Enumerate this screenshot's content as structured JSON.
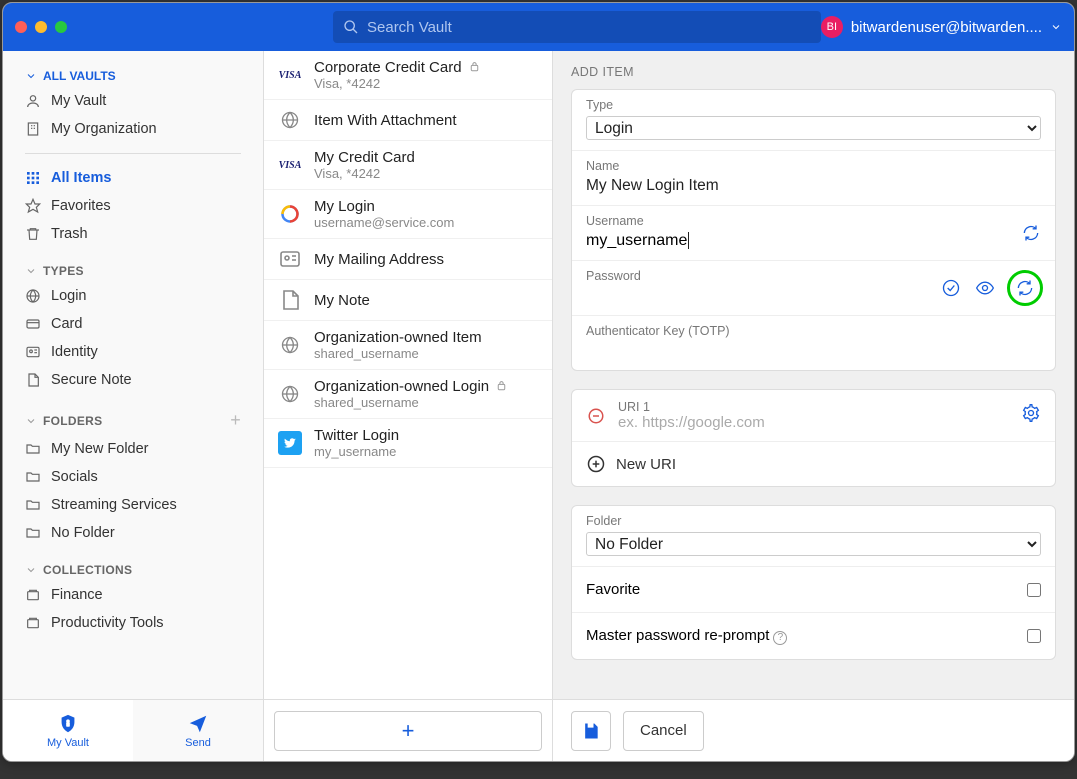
{
  "search": {
    "placeholder": "Search Vault"
  },
  "user": {
    "initials": "BI",
    "email": "bitwardenuser@bitwarden...."
  },
  "sidebar": {
    "all_vaults": "ALL VAULTS",
    "vaults": [
      "My Vault",
      "My Organization"
    ],
    "all_items": "All Items",
    "favorites": "Favorites",
    "trash": "Trash",
    "types_header": "TYPES",
    "types": [
      "Login",
      "Card",
      "Identity",
      "Secure Note"
    ],
    "folders_header": "FOLDERS",
    "folders": [
      "My New Folder",
      "Socials",
      "Streaming Services",
      "No Folder"
    ],
    "collections_header": "COLLECTIONS",
    "collections": [
      "Finance",
      "Productivity Tools"
    ],
    "tab_vault": "My Vault",
    "tab_send": "Send"
  },
  "items": [
    {
      "title": "Corporate Credit Card",
      "sub": "Visa, *4242",
      "icon": "visa",
      "attachment": true
    },
    {
      "title": "Item With Attachment",
      "sub": "",
      "icon": "globe"
    },
    {
      "title": "My Credit Card",
      "sub": "Visa, *4242",
      "icon": "visa"
    },
    {
      "title": "My Login",
      "sub": "username@service.com",
      "icon": "google"
    },
    {
      "title": "My Mailing Address",
      "sub": "",
      "icon": "identity"
    },
    {
      "title": "My Note",
      "sub": "",
      "icon": "note"
    },
    {
      "title": "Organization-owned Item",
      "sub": "shared_username",
      "icon": "globe"
    },
    {
      "title": "Organization-owned Login",
      "sub": "shared_username",
      "icon": "globe",
      "attachment": true
    },
    {
      "title": "Twitter Login",
      "sub": "my_username",
      "icon": "twitter"
    }
  ],
  "detail": {
    "header": "ADD ITEM",
    "type_label": "Type",
    "type_value": "Login",
    "name_label": "Name",
    "name_value": "My New Login Item",
    "username_label": "Username",
    "username_value": "my_username",
    "password_label": "Password",
    "totp_label": "Authenticator Key (TOTP)",
    "uri1_label": "URI 1",
    "uri1_placeholder": "ex. https://google.com",
    "new_uri": "New URI",
    "folder_label": "Folder",
    "folder_value": "No Folder",
    "favorite_label": "Favorite",
    "reprompt_label": "Master password re-prompt",
    "cancel": "Cancel"
  }
}
